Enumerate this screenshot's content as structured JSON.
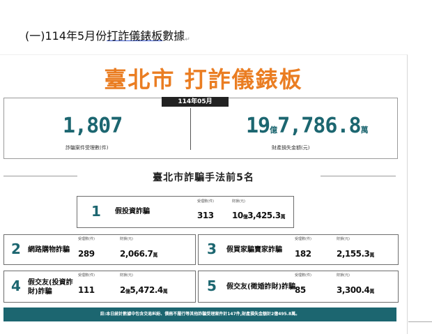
{
  "heading": {
    "prefix": "(一)114年5月份",
    "underlined": "打詐儀錶板",
    "suffix": "數據",
    "return_mark": "↵"
  },
  "dashboard": {
    "title": "臺北市 打詐儀錶板",
    "month": "114年05月",
    "cases": {
      "value": "1,807",
      "label": "詐騙案件受理數(件)"
    },
    "loss": {
      "part1": "19",
      "unit1": "億",
      "part2": "7,786.8",
      "unit2": "萬",
      "label": "財產損失金額(元)"
    }
  },
  "section_title": "臺北市詐騙手法前5名",
  "labels": {
    "cases": "受理數(件)",
    "loss": "財損(元)"
  },
  "top5": [
    {
      "rank": "1",
      "name": "假投資詐騙",
      "cases": "313",
      "loss_a": "10",
      "unit_a": "億",
      "loss_b": "3,425.3",
      "unit_b": "萬"
    },
    {
      "rank": "2",
      "name": "網路購物詐騙",
      "cases": "289",
      "loss_a": "2,066.7",
      "unit_a": "萬",
      "loss_b": "",
      "unit_b": ""
    },
    {
      "rank": "3",
      "name": "假買家騙賣家詐騙",
      "cases": "182",
      "loss_a": "2,155.3",
      "unit_a": "萬",
      "loss_b": "",
      "unit_b": ""
    },
    {
      "rank": "4",
      "name": "假交友(投資詐財)詐騙",
      "cases": "111",
      "loss_a": "2",
      "unit_a": "億",
      "loss_b": "5,472.4",
      "unit_b": "萬"
    },
    {
      "rank": "5",
      "name": "假交友(徵婚詐財)詐騙",
      "cases": "85",
      "loss_a": "3,300.4",
      "unit_a": "萬",
      "loss_b": "",
      "unit_b": ""
    }
  ],
  "footer": "註:本日統計數據中包含交易糾紛、債務不履行等其他詐騙受理案件計147件,財產損失金額計2億495.8萬。"
}
